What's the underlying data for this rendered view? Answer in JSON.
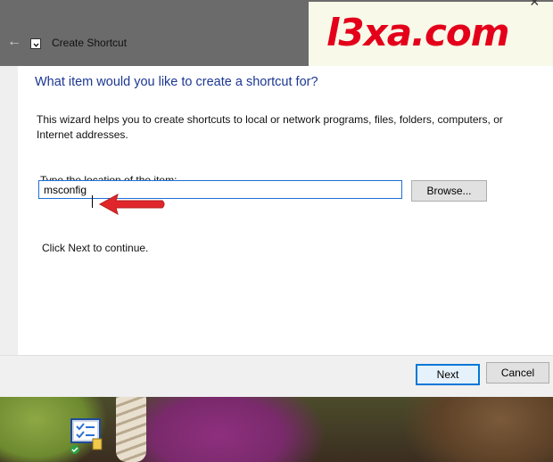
{
  "window": {
    "title": "Create Shortcut"
  },
  "watermark": {
    "text": "l3xa.com"
  },
  "wizard": {
    "heading": "What item would you like to create a shortcut for?",
    "description": "This wizard helps you to create shortcuts to local or network programs, files, folders, computers, or Internet addresses.",
    "location_label": "Type the location of the item:",
    "location_value": "msconfig",
    "browse_label": "Browse...",
    "continue_hint": "Click Next to continue."
  },
  "footer": {
    "next_label": "Next",
    "cancel_label": "Cancel"
  },
  "colors": {
    "heading": "#1c3793",
    "accent": "#0078d7",
    "annotation": "#e1262b",
    "watermark": "#e4001a"
  },
  "icons": [
    "back-arrow-icon",
    "shortcut-app-icon",
    "desktop-msconfig-icon",
    "annotation-arrow"
  ]
}
